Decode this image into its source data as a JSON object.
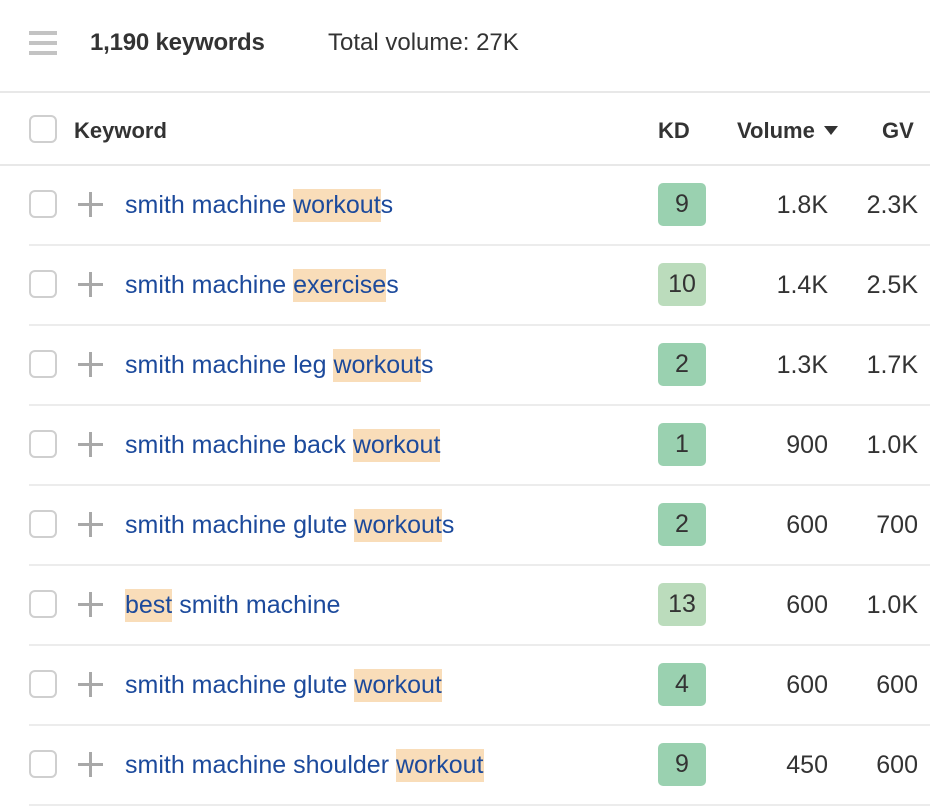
{
  "topbar": {
    "menu_icon": "hamburger-menu-icon",
    "keyword_count": "1,190 keywords",
    "total_volume": "Total volume: 27K"
  },
  "table": {
    "columns": {
      "keyword": "Keyword",
      "kd": "KD",
      "volume": "Volume",
      "gv": "GV"
    },
    "sort": {
      "column": "Volume",
      "direction": "descending",
      "icon": "caret-down-icon"
    },
    "kd_colors": {
      "low": "#9ad1b0",
      "medium_low": "#bbdcbc"
    },
    "highlight_color": "#f9ddb9",
    "link_color": "#1c4a9c",
    "rows": [
      {
        "segments": [
          {
            "text": "smith machine ",
            "hl": false
          },
          {
            "text": "workout",
            "hl": true
          },
          {
            "text": "s",
            "hl": false
          }
        ],
        "keyword": "smith machine workouts",
        "kd": "9",
        "kd_color": "#9ad1b0",
        "volume": "1.8K",
        "gv": "2.3K"
      },
      {
        "segments": [
          {
            "text": "smith machine ",
            "hl": false
          },
          {
            "text": "exercise",
            "hl": true
          },
          {
            "text": "s",
            "hl": false
          }
        ],
        "keyword": "smith machine exercises",
        "kd": "10",
        "kd_color": "#bbdcbc",
        "volume": "1.4K",
        "gv": "2.5K"
      },
      {
        "segments": [
          {
            "text": "smith machine leg ",
            "hl": false
          },
          {
            "text": "workout",
            "hl": true
          },
          {
            "text": "s",
            "hl": false
          }
        ],
        "keyword": "smith machine leg workouts",
        "kd": "2",
        "kd_color": "#9ad1b0",
        "volume": "1.3K",
        "gv": "1.7K"
      },
      {
        "segments": [
          {
            "text": "smith machine back ",
            "hl": false
          },
          {
            "text": "workout",
            "hl": true
          }
        ],
        "keyword": "smith machine back workout",
        "kd": "1",
        "kd_color": "#9ad1b0",
        "volume": "900",
        "gv": "1.0K"
      },
      {
        "segments": [
          {
            "text": "smith machine glute ",
            "hl": false
          },
          {
            "text": "workout",
            "hl": true
          },
          {
            "text": "s",
            "hl": false
          }
        ],
        "keyword": "smith machine glute workouts",
        "kd": "2",
        "kd_color": "#9ad1b0",
        "volume": "600",
        "gv": "700"
      },
      {
        "segments": [
          {
            "text": "best",
            "hl": true
          },
          {
            "text": " smith machine",
            "hl": false
          }
        ],
        "keyword": "best smith machine",
        "kd": "13",
        "kd_color": "#bbdcbc",
        "volume": "600",
        "gv": "1.0K"
      },
      {
        "segments": [
          {
            "text": "smith machine glute ",
            "hl": false
          },
          {
            "text": "workout",
            "hl": true
          }
        ],
        "keyword": "smith machine glute workout",
        "kd": "4",
        "kd_color": "#9ad1b0",
        "volume": "600",
        "gv": "600"
      },
      {
        "segments": [
          {
            "text": "smith machine shoulder ",
            "hl": false
          },
          {
            "text": "workout",
            "hl": true
          }
        ],
        "keyword": "smith machine shoulder workout",
        "kd": "9",
        "kd_color": "#9ad1b0",
        "volume": "450",
        "gv": "600"
      }
    ]
  }
}
